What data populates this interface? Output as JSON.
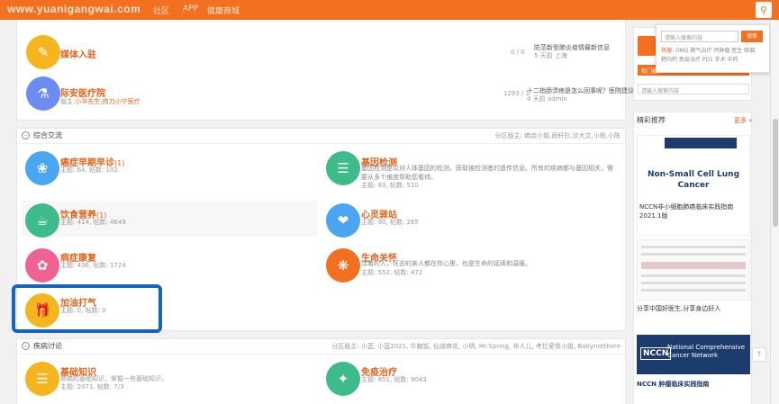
{
  "header": {
    "brand": "www.yuanigangwai.com",
    "nav": [
      "社区",
      "APP",
      "健康商城"
    ]
  },
  "top_forums": [
    {
      "title": "媒体入驻",
      "stats": "0 / 0",
      "last": "防范新型肺炎疫情最新信息",
      "last_sub": "5 天前 上海"
    },
    {
      "title": "际安医疗院",
      "desc_prefix": "版主:",
      "desc_hl": "小华先生,肉刀小宁医疗",
      "stats": "1293 / 1",
      "last": "十二指肠溃疡是怎么回事呢？医院建议",
      "last_sub": "4 天前 admin"
    }
  ],
  "section1": {
    "title": "综合交流",
    "mods": "分区版主: 癌症小姐,雨轩杉,诊大文,小杨,小陈"
  },
  "forums": [
    {
      "title": "癌症早期早诊",
      "count": "(1)",
      "stats": "主题: 64, 帖数: 102"
    },
    {
      "title": "基因检测",
      "desc": "基因检测是以对人体基因的检测，获取被检测者的遗传信息。所有的疾病都与基因相关，需要从多个维度帮助您看待。",
      "stats": "主题: 83, 帖数: 510"
    },
    {
      "title": "饮食营养",
      "count": "(1)",
      "stats": "主题: 414, 帖数: 4649"
    },
    {
      "title": "心灵驿站",
      "stats": "主题: 90, 帖数: 265"
    },
    {
      "title": "病症康复",
      "stats": "主题: 436, 帖数: 1724"
    },
    {
      "title": "生命关怀",
      "desc": "活着的人，死去的亲人都在你心里，也是生命的延续和温暖。",
      "stats": "主题: 552, 帖数: 472"
    },
    {
      "title": "加油打气",
      "stats": "主题: 0, 帖数: 0"
    }
  ],
  "section2": {
    "title": "疾病讨论",
    "mods": "分区版主: 小蓝, 小蓝2021, 牛腩饭, 仙道麻花, 小明, Mr.Spring, 布人儿, 考拉爱情小姐, Babynotthere"
  },
  "forums2": [
    {
      "title": "基础知识",
      "desc": "肺癌的基础知识，掌握一些基础知识，",
      "stats": "主题: 2071, 帖数: 7/3"
    },
    {
      "title": "免疫治疗",
      "stats": "主题: 851, 帖数: 9043"
    }
  ],
  "search_dropdown": {
    "placeholder": "请输入搜索内容",
    "button": "搜索",
    "tags_line1_hl": "热搜:",
    "tags_line1": "OMG 肺气治疗 钙肿瘤 医生 吸烟",
    "tags_line2": "靶向药 免疫治疗 PD1 手术 中药"
  },
  "right": {
    "search_box_placeholder": "请输入搜索内容",
    "hot_label": "热门搜索",
    "recommend_title": "精彩推荐",
    "more": "更多 »",
    "ad1_title_line1": "Non-Small Cell Lung",
    "ad1_title_line2": "Cancer",
    "ad1_caption": "NCCN非小细胞肺癌临床实践指南2021.1版",
    "ad2_caption": "分享中国好医生,分享身边好人",
    "ad2_title": "National Comprehensive Cancer Network",
    "ad2_brand": "NCCN",
    "ad2_footer": "NCCN 肿瘤临床实践指南"
  }
}
